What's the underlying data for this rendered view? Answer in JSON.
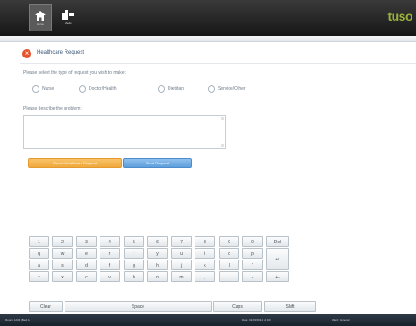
{
  "topbar": {
    "home_label": "Home",
    "meds_label": "Meds",
    "brand": "tuso"
  },
  "request": {
    "title": "Healthcare Request",
    "instruction_type": "Please select the type of request you wish to make:",
    "options": [
      "Nurse",
      "Doctor/Health",
      "Dietitian",
      "Service/Other"
    ],
    "instruction_problem": "Please describe the problem:",
    "problem_text": "",
    "btn_orange": "Cancel Healthcare Request",
    "btn_blue": "Send Request"
  },
  "keyboard": {
    "row1": [
      "1",
      "2",
      "3",
      "4",
      "5",
      "6",
      "7",
      "8",
      "9",
      "0",
      "Del"
    ],
    "row2": [
      "q",
      "w",
      "e",
      "r",
      "t",
      "y",
      "u",
      "i",
      "o",
      "p"
    ],
    "row3": [
      "a",
      "s",
      "d",
      "f",
      "g",
      "h",
      "j",
      "k",
      "l",
      "'"
    ],
    "row4": [
      "z",
      "x",
      "c",
      "v",
      "b",
      "n",
      "m",
      ",",
      ".",
      "-",
      "+-"
    ],
    "row5": [
      "Clear",
      "Space",
      "Caps",
      "Shift"
    ],
    "enter_symbol": "↵"
  },
  "status": {
    "left": "Room: 1234 | Bed A",
    "mid": "Date: 01/01/2014 12:00",
    "right": "Ward: General"
  }
}
